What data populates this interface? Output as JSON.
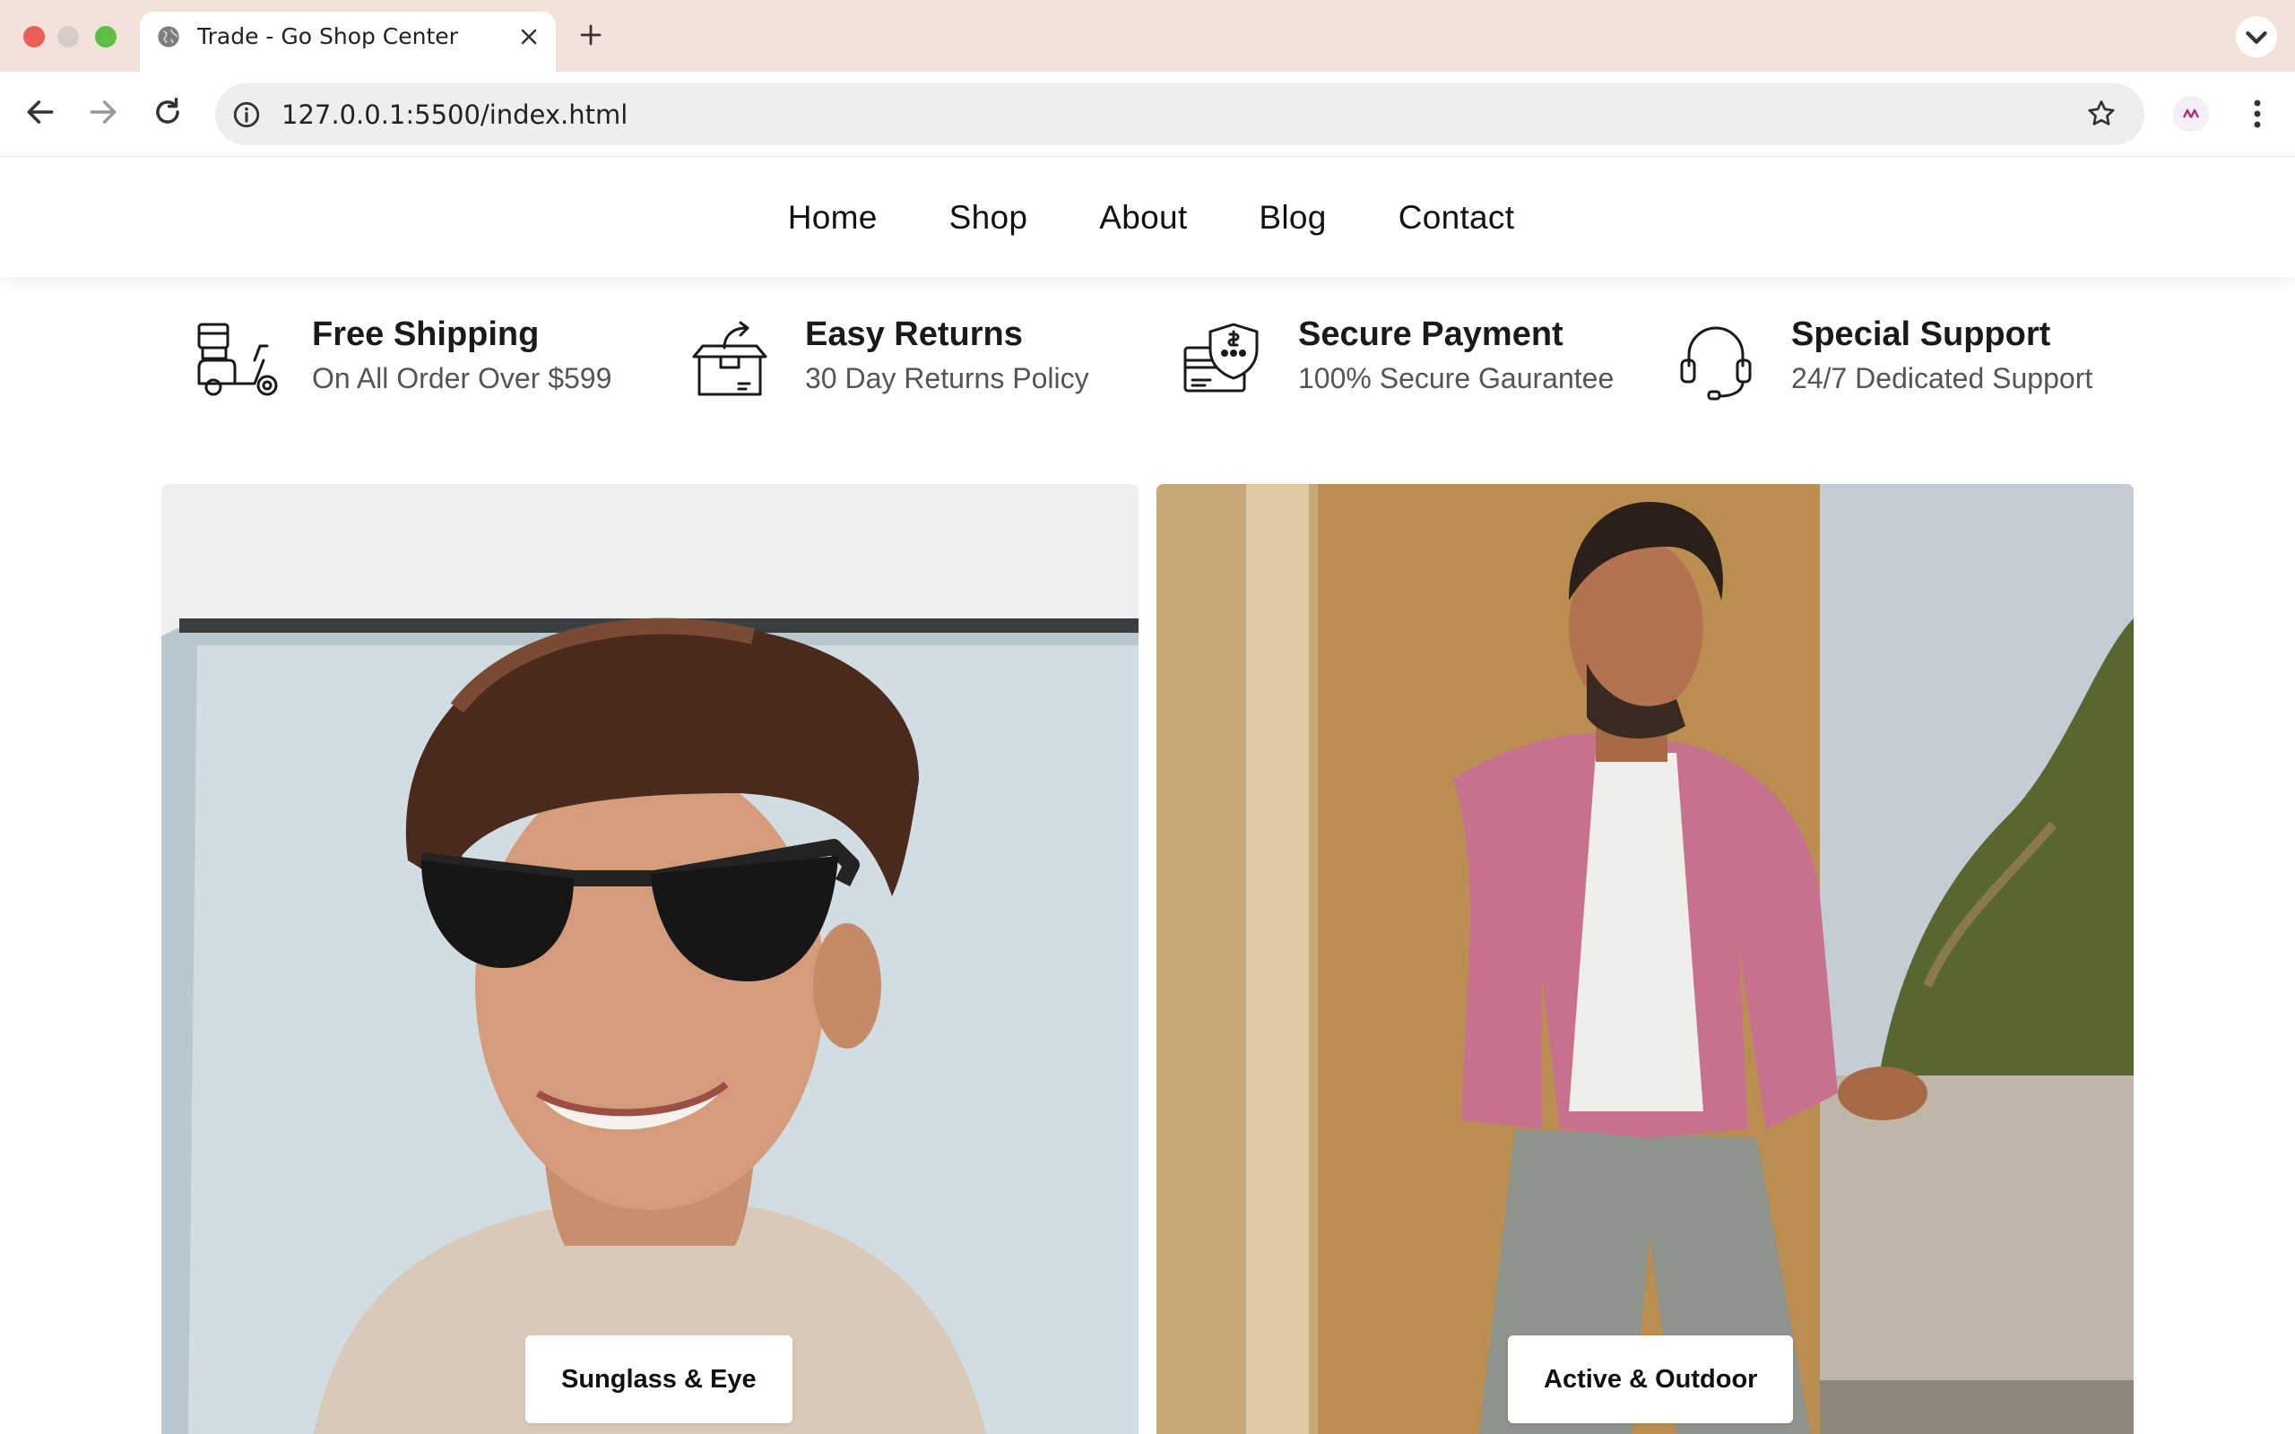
{
  "browser": {
    "tab_title": "Trade - Go Shop Center",
    "url": "127.0.0.1:5500/index.html",
    "icons": [
      "globe-icon",
      "close-icon",
      "plus-icon",
      "chevron-down-icon",
      "back-icon",
      "forward-icon",
      "reload-icon",
      "info-icon",
      "star-icon",
      "profile-icon",
      "kebab-icon"
    ]
  },
  "nav": {
    "items": [
      {
        "label": "Home"
      },
      {
        "label": "Shop"
      },
      {
        "label": "About"
      },
      {
        "label": "Blog"
      },
      {
        "label": "Contact"
      }
    ]
  },
  "features": [
    {
      "icon": "scooter-delivery-icon",
      "title": "Free Shipping",
      "subtitle": "On All Order Over $599"
    },
    {
      "icon": "return-box-icon",
      "title": "Easy Returns",
      "subtitle": "30 Day Returns Policy"
    },
    {
      "icon": "secure-card-icon",
      "title": "Secure Payment",
      "subtitle": "100% Secure Gaurantee"
    },
    {
      "icon": "headset-icon",
      "title": "Special Support",
      "subtitle": "24/7 Dedicated Support"
    }
  ],
  "banners": [
    {
      "button_label": "Sunglass & Eye"
    },
    {
      "button_label": "Active & Outdoor"
    }
  ],
  "colors": {
    "tabstrip_bg": "#f2e2da",
    "text_dark": "#111111",
    "text_muted": "#555555"
  }
}
